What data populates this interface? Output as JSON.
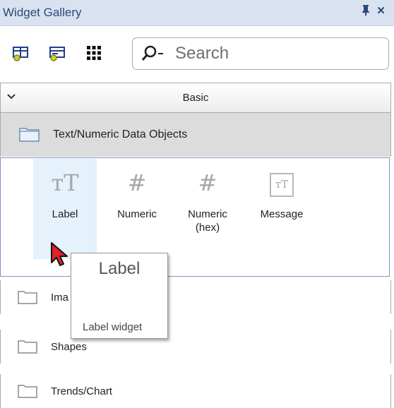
{
  "panel": {
    "title": "Widget Gallery",
    "pin_icon": "pin-icon",
    "close_icon": "close-icon",
    "close_glyph": "×",
    "pin_glyph": "ᵽ"
  },
  "toolbar": {
    "buttons": [
      "add-widget-icon",
      "edit-widget-icon",
      "grid-view-icon"
    ],
    "search_placeholder": "Search"
  },
  "group": {
    "label": "Basic"
  },
  "categories": {
    "selected": "Text/Numeric Data Objects",
    "items": [
      "Ima",
      "Shapes",
      "Trends/Chart"
    ]
  },
  "widgets": [
    {
      "glyph": "ᴛT",
      "label": "Label"
    },
    {
      "glyph": "#",
      "label": "Numeric"
    },
    {
      "glyph": "#",
      "label": "Numeric\n(hex)"
    },
    {
      "glyph": "ᴛT",
      "label": "Message"
    }
  ],
  "tooltip": {
    "title": "Label",
    "description": "Label widget"
  },
  "colors": {
    "titlebar": "#d9e2f1",
    "title_text": "#2d4a78",
    "hover": "#e5f1fb",
    "selected_category": "#dcdcdc",
    "cursor": "#e0202a"
  }
}
